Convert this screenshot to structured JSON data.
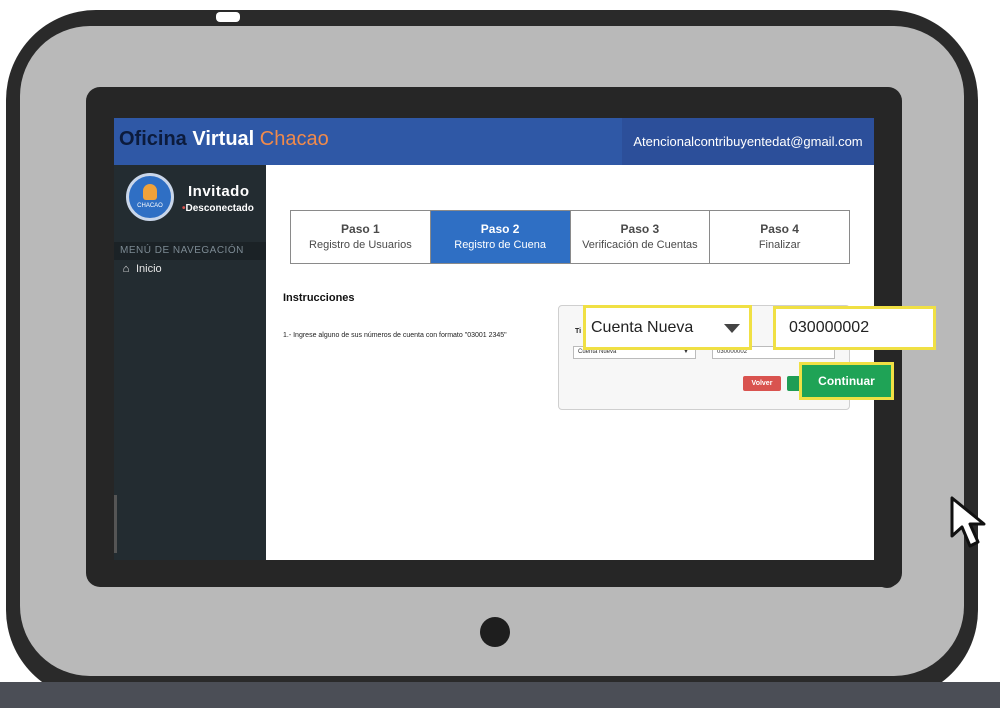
{
  "header": {
    "brand_part1": "Oficina",
    "brand_part2": "Virtual",
    "brand_part3": "Chacao",
    "email": "Atencionalcontribuyentedat@gmail.com"
  },
  "sidebar": {
    "avatar_text": "CHACAO",
    "user_name": "Invitado",
    "user_status": "Desconectado",
    "nav_header": "MENÚ DE NAVEGACIÓN",
    "nav_items": [
      {
        "label": "Inicio",
        "icon": "home-icon"
      }
    ]
  },
  "steps": [
    {
      "num": "Paso 1",
      "label": "Registro de Usuarios",
      "active": false
    },
    {
      "num": "Paso 2",
      "label": "Registro de Cuena",
      "active": true
    },
    {
      "num": "Paso 3",
      "label": "Verificación de Cuentas",
      "active": false
    },
    {
      "num": "Paso 4",
      "label": "Finalizar",
      "active": false
    }
  ],
  "instructions": {
    "title": "Instrucciones",
    "line1": "1.- Ingrese alguno de sus números de cuenta con formato \"03001 2345\""
  },
  "form": {
    "label_partial": "Ti",
    "select_value": "Cuenta Nueva",
    "input_value": "030000002",
    "volver_label": "Volver",
    "continuar_label": "Continuar"
  },
  "colors": {
    "topbar": "#2f58a6",
    "active_step": "#2f6fc4",
    "highlight": "#f0e044",
    "continuar": "#1fa356",
    "volver": "#d9534f"
  }
}
